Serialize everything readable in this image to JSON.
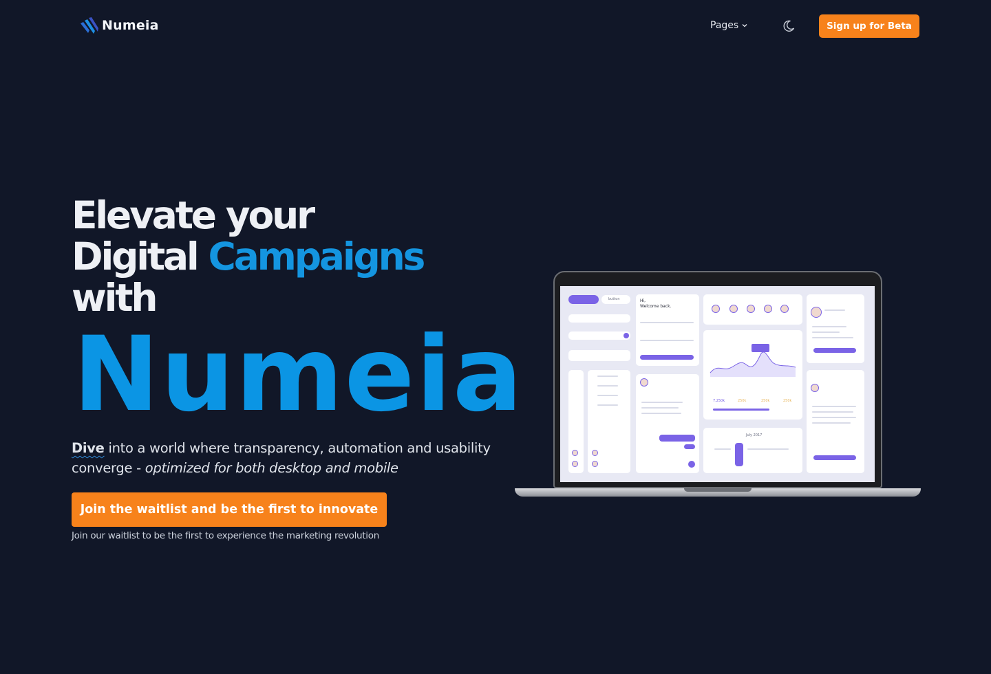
{
  "nav": {
    "brand": "Numeia",
    "pages_label": "Pages",
    "signup_label": "Sign up for Beta"
  },
  "hero": {
    "line1": "Elevate your",
    "line2_a": "Digital",
    "line2_b": "Campaigns",
    "line3": "with",
    "brand_big": "Numeia",
    "sub_dive": "Dive",
    "sub_rest": " into a world where transparency, automation and usability converge - ",
    "sub_italic": "optimized for both desktop and mobile",
    "cta_label": "Join the waitlist and be the first to innovate",
    "cta_note": "Join our waitlist to be the first to experience the marketing revolution"
  },
  "mockup": {
    "button_text": "button",
    "welcome_hi": "Hi,",
    "welcome_text": "Welcome back.",
    "stats": [
      "7.250k",
      "250k",
      "250k",
      "250k"
    ],
    "calendar_month": "July 2017"
  },
  "colors": {
    "background": "#111728",
    "accent_orange": "#f7821b",
    "accent_blue": "#0b95e4",
    "mockup_purple": "#7a63e6"
  },
  "icons": [
    "logo-icon",
    "chevron-down-icon",
    "moon-icon"
  ]
}
